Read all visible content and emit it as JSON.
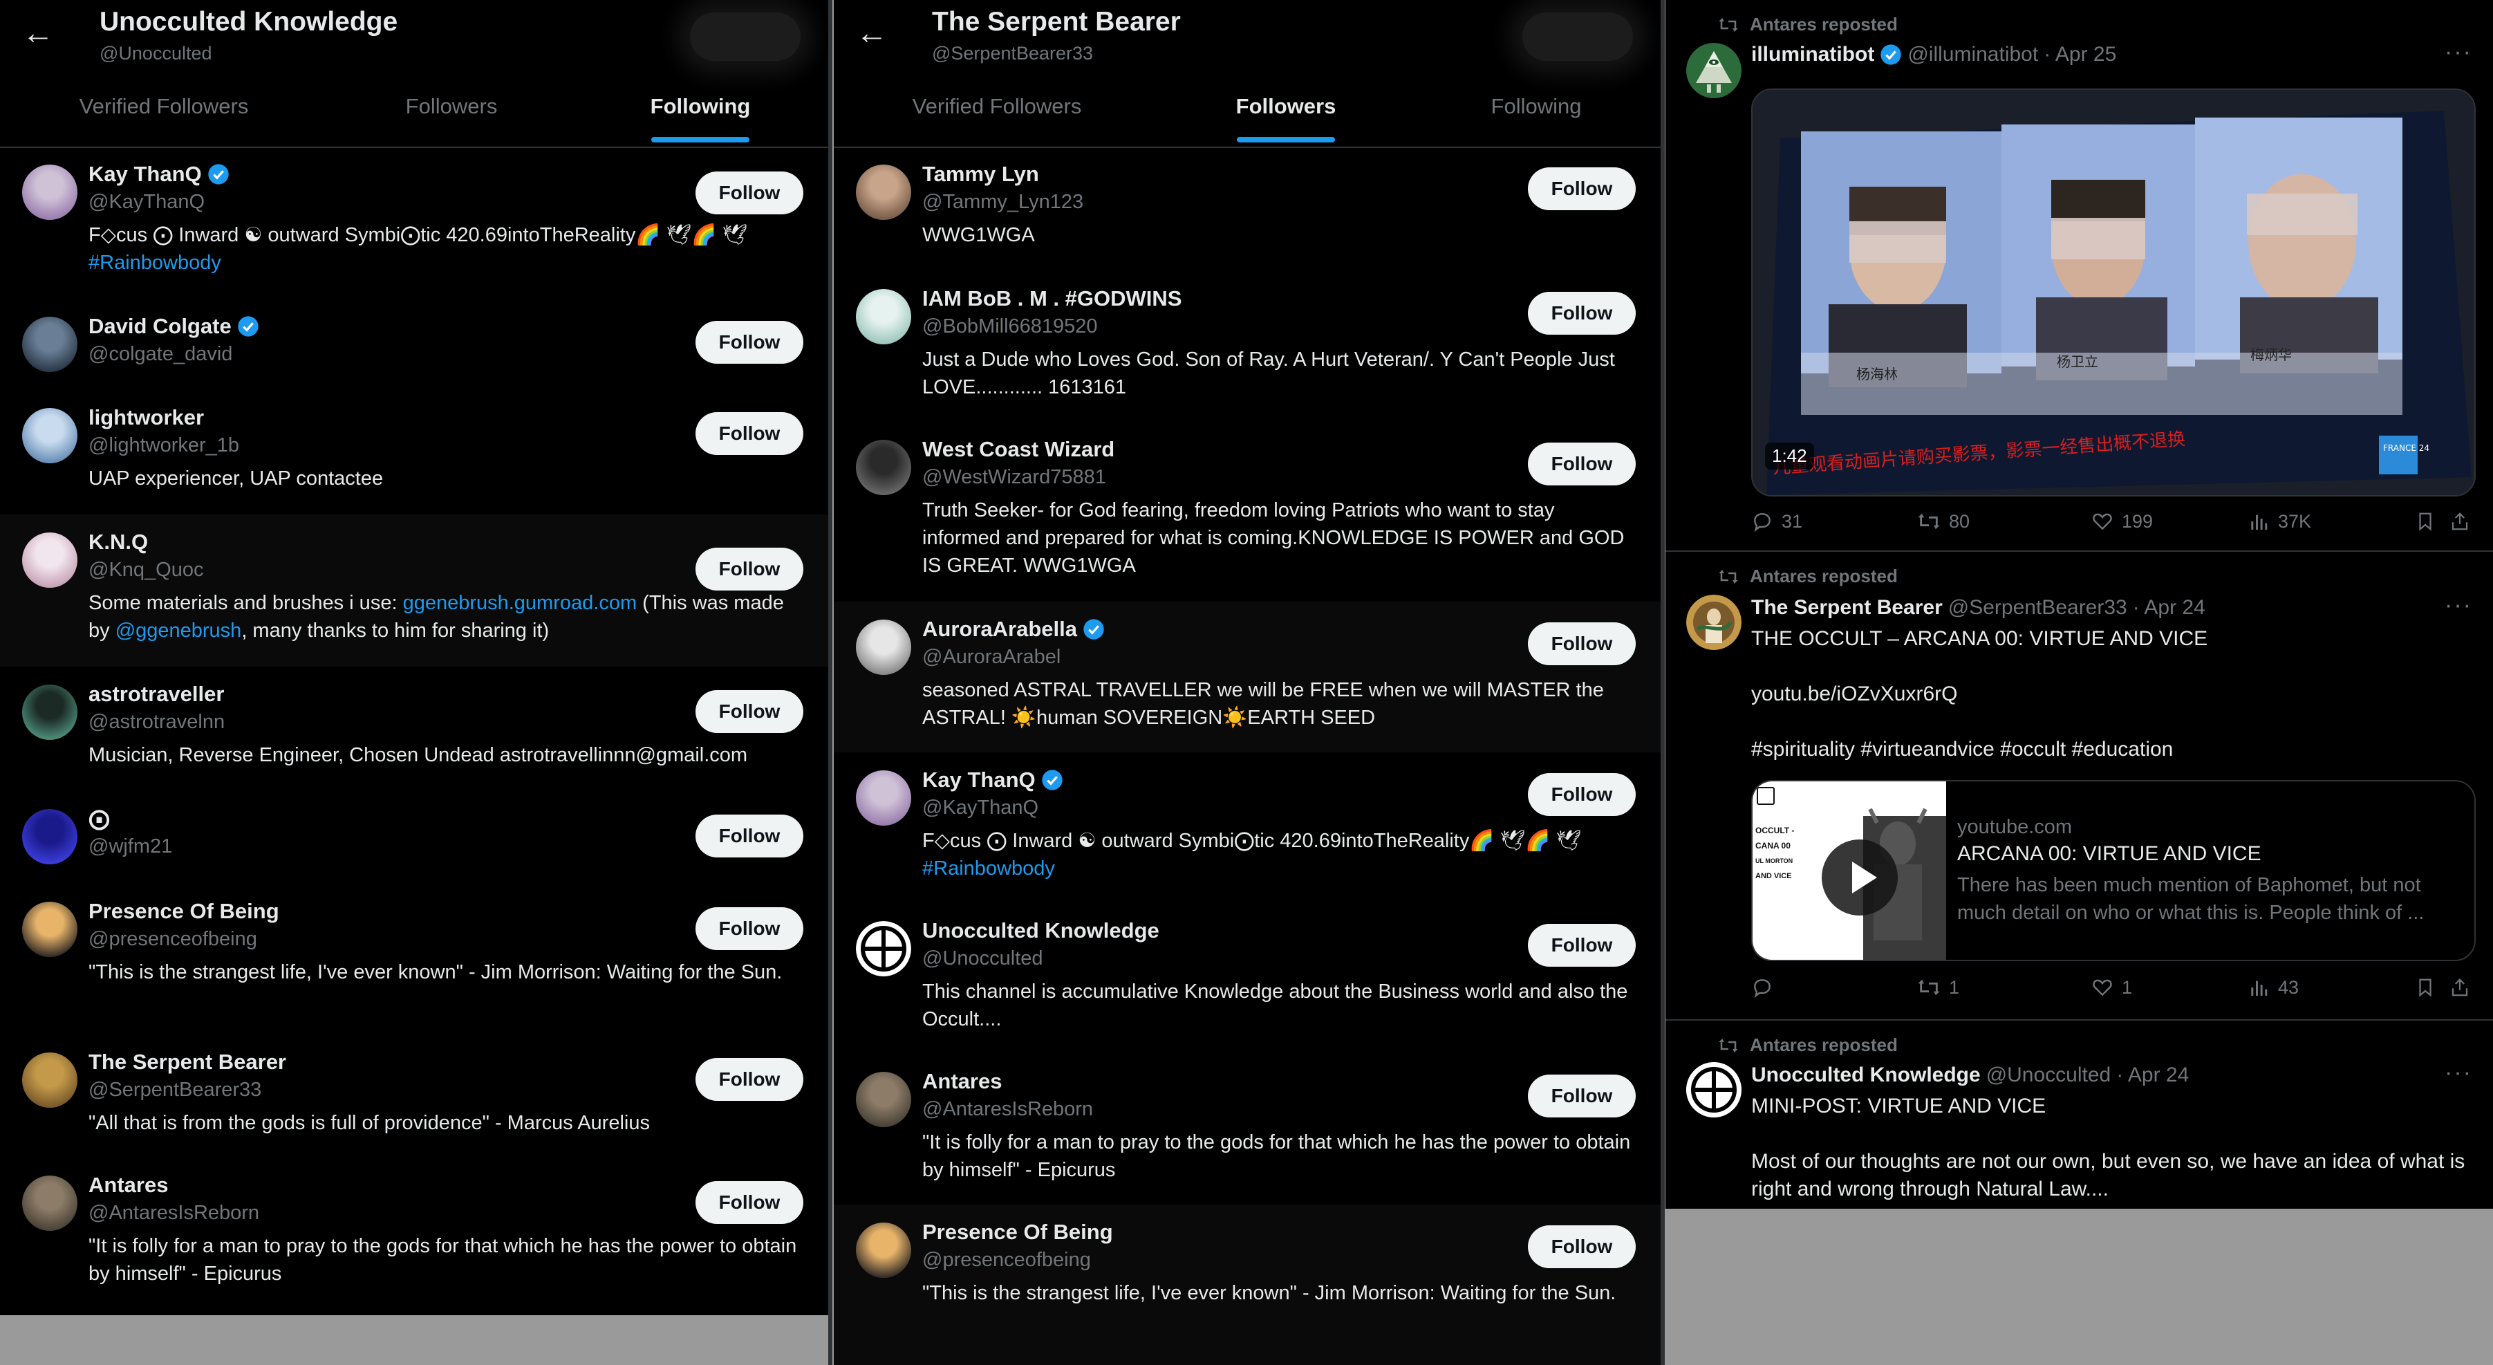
{
  "panel1": {
    "header": {
      "name": "Unocculted Knowledge",
      "handle": "@Unocculted"
    },
    "tabs": [
      "Verified Followers",
      "Followers",
      "Following"
    ],
    "active_tab": "Following",
    "users": [
      {
        "name": "Kay ThanQ",
        "verified": true,
        "handle": "@KayThanQ",
        "bio": "F◇cus ⨀ Inward ☯ outward Symbi⨀tic 420.69intoTheReality🌈 🕊🌈 🕊",
        "bio_tag": "#Rainbowbody",
        "follow": "Follow"
      },
      {
        "name": "David Colgate",
        "verified": true,
        "handle": "@colgate_david",
        "bio": "",
        "follow": "Follow"
      },
      {
        "name": "lightworker",
        "verified": false,
        "handle": "@lightworker_1b",
        "bio": "UAP experiencer, UAP contactee",
        "follow": "Follow"
      },
      {
        "name": "K.N.Q",
        "verified": false,
        "handle": "@Knq_Quoc",
        "bio_pre": "Some materials and brushes i use: ",
        "bio_link": "ggenebrush.gumroad.com",
        "bio_mid": " (This was made by ",
        "bio_mention": "@ggenebrush",
        "bio_post": ", many thanks to him for sharing it)",
        "follow": "Follow"
      },
      {
        "name": "astrotraveller",
        "verified": false,
        "handle": "@astrotravelnn",
        "bio": "Musician, Reverse Engineer, Chosen Undead astrotravellinnn@gmail.com",
        "follow": "Follow"
      },
      {
        "name": "⨀",
        "verified": false,
        "handle": "@wjfm21",
        "bio": "",
        "follow": "Follow"
      },
      {
        "name": "Presence Of Being",
        "verified": false,
        "handle": "@presenceofbeing",
        "bio": "\"This is the strangest life, I've ever known\" - Jim Morrison: Waiting for the Sun.",
        "follow": "Follow"
      },
      {
        "name": "The Serpent Bearer",
        "verified": false,
        "handle": "@SerpentBearer33",
        "bio": "\"All that is from the gods is full of providence\" - Marcus Aurelius",
        "follow": "Follow"
      },
      {
        "name": "Antares",
        "verified": false,
        "handle": "@AntaresIsReborn",
        "bio": "\"It is folly for a man to pray to the gods for that which he has the power to obtain by himself\" - Epicurus",
        "follow": "Follow"
      }
    ]
  },
  "panel2": {
    "header": {
      "name": "The Serpent Bearer",
      "handle": "@SerpentBearer33"
    },
    "tabs": [
      "Verified Followers",
      "Followers",
      "Following"
    ],
    "active_tab": "Followers",
    "users": [
      {
        "name": "Tammy Lyn",
        "verified": false,
        "handle": "@Tammy_Lyn123",
        "bio": "WWG1WGA",
        "follow": "Follow"
      },
      {
        "name": "IAM BoB . M . #GODWINS",
        "verified": false,
        "handle": "@BobMill66819520",
        "bio": "Just a Dude who Loves God. Son of Ray. A Hurt Veteran/. Y Can't People Just LOVE............ 1613161",
        "follow": "Follow"
      },
      {
        "name": "West Coast Wizard",
        "verified": false,
        "handle": "@WestWizard75881",
        "bio": "Truth Seeker- for God fearing, freedom loving Patriots who want to stay informed and prepared for what is coming.KNOWLEDGE IS POWER and GOD IS GREAT. WWG1WGA",
        "follow": "Follow"
      },
      {
        "name": "AuroraArabella",
        "verified": true,
        "handle": "@AuroraArabel",
        "bio": "seasoned ASTRAL TRAVELLER we will be FREE when we will MASTER the ASTRAL! ☀️human SOVEREIGN☀️EARTH SEED",
        "follow": "Follow"
      },
      {
        "name": "Kay ThanQ",
        "verified": true,
        "handle": "@KayThanQ",
        "bio": "F◇cus ⨀ Inward ☯ outward Symbi⨀tic 420.69intoTheReality🌈 🕊🌈 🕊",
        "bio_tag": "#Rainbowbody",
        "follow": "Follow"
      },
      {
        "name": "Unocculted Knowledge",
        "verified": false,
        "handle": "@Unocculted",
        "bio": "This channel is accumulative Knowledge about the Business world and also the Occult....",
        "follow": "Follow"
      },
      {
        "name": "Antares",
        "verified": false,
        "handle": "@AntaresIsReborn",
        "bio": "\"It is folly for a man to pray to the gods for that which he has the power to obtain by himself\" - Epicurus",
        "follow": "Follow"
      },
      {
        "name": "Presence Of Being",
        "verified": false,
        "handle": "@presenceofbeing",
        "bio": "\"This is the strangest life, I've ever known\" - Jim Morrison: Waiting for the Sun.",
        "follow": "Follow"
      }
    ]
  },
  "panel3": {
    "posts": [
      {
        "repost_label": "Antares reposted",
        "name": "illuminatibot",
        "verified": true,
        "handle": "@illuminatibot",
        "date": "· Apr 25",
        "video_duration": "1:42",
        "video_caption": "儿童观看动画片请购买影票，影票一经售出概不退换",
        "video_names": [
          "杨海林",
          "杨卫立",
          "梅炳华"
        ],
        "video_badge": "FRANCE 24",
        "replies": "31",
        "reposts": "80",
        "likes": "199",
        "views": "37K"
      },
      {
        "repost_label": "Antares reposted",
        "name": "The Serpent Bearer",
        "handle": "@SerpentBearer33",
        "date": "· Apr 24",
        "text": "THE OCCULT – ARCANA 00: VIRTUE AND VICE",
        "link": "youtu.be/iOZvXuxr6rQ",
        "hashtags": "#spirituality #virtueandvice #occult #education",
        "card": {
          "domain": "youtube.com",
          "title": "ARCANA 00: VIRTUE AND VICE",
          "desc": "There has been much mention of Baphomet, but not much detail on who or what this is. People think of ...",
          "thumb_lines": [
            "OCCULT -",
            "CANA 00",
            "UL MORTON",
            "",
            "AND VICE"
          ]
        },
        "replies": "",
        "reposts": "1",
        "likes": "1",
        "views": "43"
      },
      {
        "repost_label": "Antares reposted",
        "name": "Unocculted Knowledge",
        "handle": "@Unocculted",
        "date": "· Apr 24",
        "text": "MINI-POST: VIRTUE AND VICE",
        "body": "Most of our thoughts are not our own, but even so, we have an idea of what is right and wrong through Natural Law...."
      }
    ]
  },
  "colors": {
    "accent": "#1d9bf0",
    "text": "#e7e9ea",
    "muted": "#71767b",
    "border": "#2f3336",
    "bg": "#000000"
  }
}
